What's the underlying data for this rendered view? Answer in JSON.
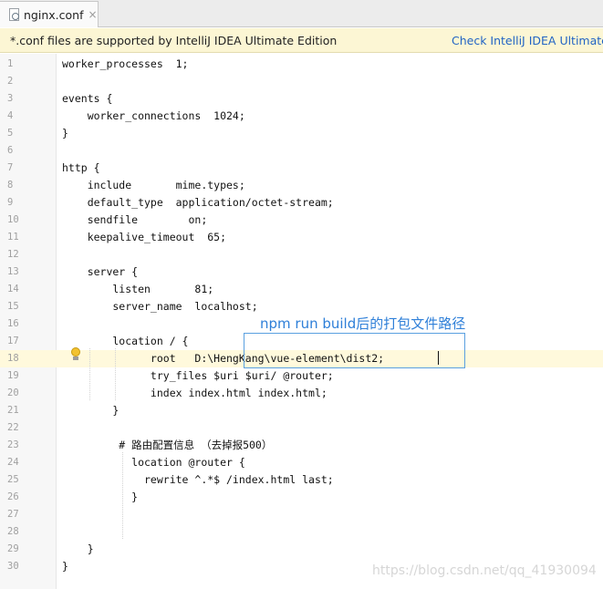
{
  "tab": {
    "label": "nginx.conf",
    "close_glyph": "×",
    "icon": "config-file-icon"
  },
  "banner": {
    "message": "*.conf files are supported by IntelliJ IDEA Ultimate Edition",
    "link": "Check IntelliJ IDEA Ultimate E"
  },
  "editor": {
    "current_line": 18,
    "lines": [
      {
        "n": "1",
        "text": "worker_processes  1;"
      },
      {
        "n": "2",
        "text": ""
      },
      {
        "n": "3",
        "text": "events {"
      },
      {
        "n": "4",
        "text": "    worker_connections  1024;"
      },
      {
        "n": "5",
        "text": "}"
      },
      {
        "n": "6",
        "text": ""
      },
      {
        "n": "7",
        "text": "http {"
      },
      {
        "n": "8",
        "text": "    include       mime.types;"
      },
      {
        "n": "9",
        "text": "    default_type  application/octet-stream;"
      },
      {
        "n": "10",
        "text": "    sendfile        on;"
      },
      {
        "n": "11",
        "text": "    keepalive_timeout  65;"
      },
      {
        "n": "12",
        "text": ""
      },
      {
        "n": "13",
        "text": "    server {"
      },
      {
        "n": "14",
        "text": "        listen       81;"
      },
      {
        "n": "15",
        "text": "        server_name  localhost;"
      },
      {
        "n": "16",
        "text": ""
      },
      {
        "n": "17",
        "text": "        location / {"
      },
      {
        "n": "18",
        "text": "              root   D:\\HengKang\\vue-element\\dist2;"
      },
      {
        "n": "19",
        "text": "              try_files $uri $uri/ @router;"
      },
      {
        "n": "20",
        "text": "              index index.html index.html;"
      },
      {
        "n": "21",
        "text": "        }"
      },
      {
        "n": "22",
        "text": ""
      },
      {
        "n": "23",
        "text": "         # 路由配置信息 （去掉报500）"
      },
      {
        "n": "24",
        "text": "           location @router {"
      },
      {
        "n": "25",
        "text": "             rewrite ^.*$ /index.html last;"
      },
      {
        "n": "26",
        "text": "           }"
      },
      {
        "n": "27",
        "text": ""
      },
      {
        "n": "28",
        "text": ""
      },
      {
        "n": "29",
        "text": "    }"
      },
      {
        "n": "30",
        "text": "}"
      }
    ]
  },
  "annotation": {
    "text": "npm run build后的打包文件路径"
  },
  "watermark": "https://blog.csdn.net/qq_41930094",
  "colors": {
    "banner_bg": "#fcf6d4",
    "link": "#2264c4",
    "annotation": "#2e7fd8",
    "current_line": "#fff9dc"
  }
}
